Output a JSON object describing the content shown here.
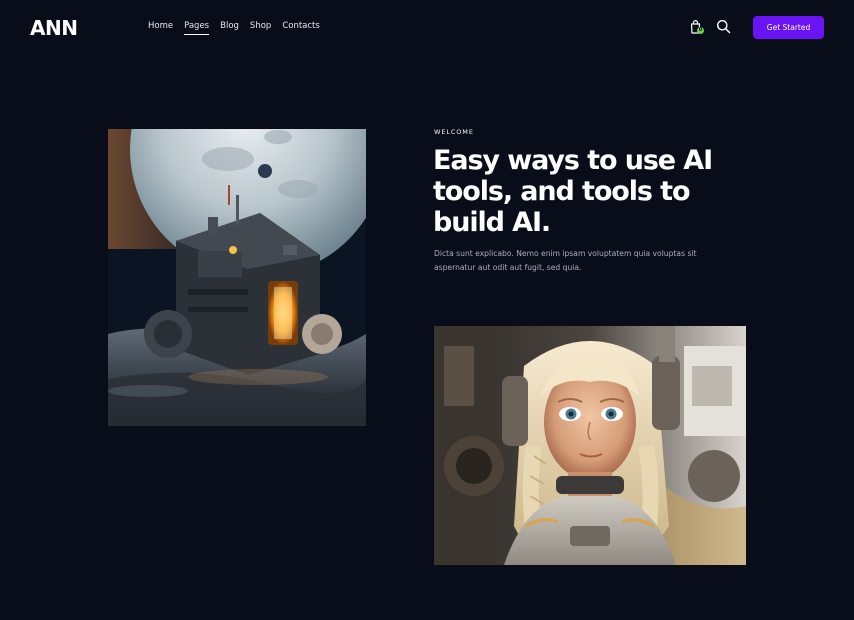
{
  "brand": {
    "logo_text": "ANN"
  },
  "nav": {
    "items": [
      {
        "label": "Home",
        "active": false
      },
      {
        "label": "Pages",
        "active": true
      },
      {
        "label": "Blog",
        "active": false
      },
      {
        "label": "Shop",
        "active": false
      },
      {
        "label": "Contacts",
        "active": false
      }
    ]
  },
  "header": {
    "cart_icon": "shopping-bag-icon",
    "cart_count": "0",
    "search_icon": "search-icon",
    "cta_label": "Get Started"
  },
  "hero": {
    "eyebrow": "WELCOME",
    "headline": "Easy ways to use AI tools, and tools to build AI.",
    "body": "Dicta sunt explicabo. Nemo enim ipsam voluptatem quia voluptas sit aspernatur aut odit aut fugit, sed quia."
  },
  "colors": {
    "background": "#090c19",
    "accent": "#6914f5",
    "badge": "#6fd14c",
    "body_text": "#a9aec0"
  }
}
